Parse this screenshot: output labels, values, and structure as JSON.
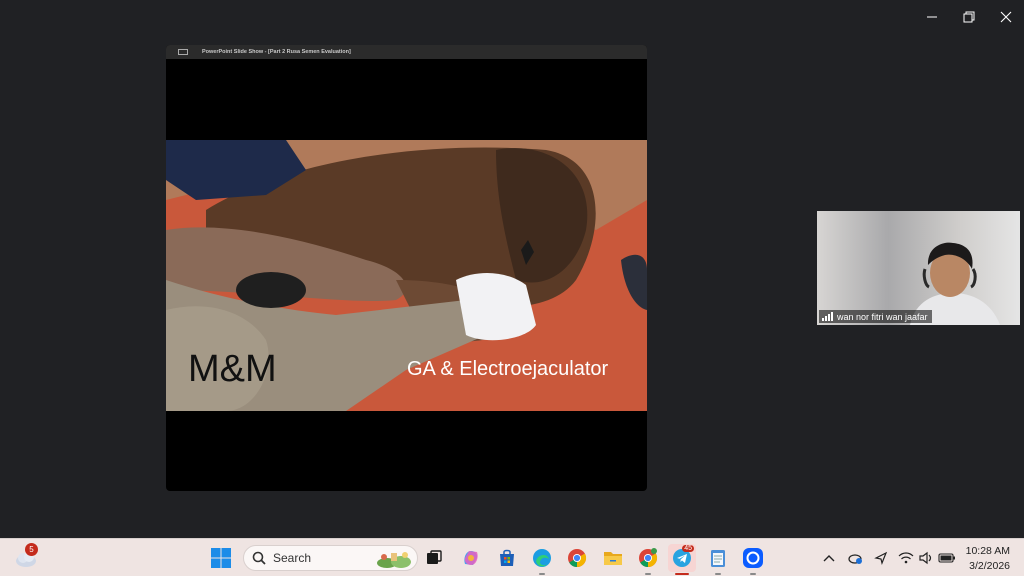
{
  "window": {
    "controls": [
      "minimize",
      "restore",
      "close"
    ]
  },
  "share": {
    "window_title": "PowerPoint Slide Show - [Part 2 Rusa Semen Evaluation]",
    "slide": {
      "title": "M&M",
      "subtitle": "GA & Electroejaculator"
    }
  },
  "participant": {
    "name": "wan nor fitri wan jaafar"
  },
  "taskbar": {
    "weather_badge": "5",
    "search_placeholder": "Search",
    "telegram_badge": "45",
    "clock": {
      "time": "10:28 AM",
      "date": "3/2/2026"
    },
    "apps": [
      "task-view",
      "copilot",
      "store",
      "edge",
      "chrome",
      "file-explorer",
      "chrome-profile",
      "telegram",
      "notepad",
      "zoom"
    ]
  }
}
